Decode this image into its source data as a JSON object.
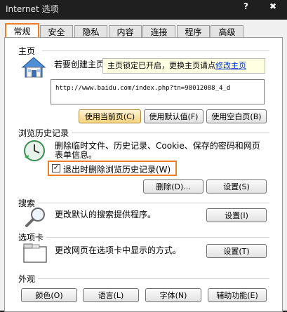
{
  "window": {
    "title": "Internet 选项",
    "help_glyph": "?",
    "close_glyph": "✖"
  },
  "tabs": [
    {
      "label": "常规",
      "active": true
    },
    {
      "label": "安全"
    },
    {
      "label": "隐私"
    },
    {
      "label": "内容"
    },
    {
      "label": "连接"
    },
    {
      "label": "程序"
    },
    {
      "label": "高级"
    }
  ],
  "home": {
    "group": "主页",
    "desc": "若要创建主页",
    "tooltip_text": "主页锁定已开启，更换主页请点",
    "tooltip_link": "修改主页",
    "url": "http://www.baidu.com/index.php?tn=98012088_4_d",
    "buttons": {
      "current": "使用当前页(C)",
      "default": "使用默认值(F)",
      "blank": "使用空白页(B)"
    }
  },
  "history": {
    "group": "浏览历史记录",
    "desc_line1": "删除临时文件、历史记录、Cookie、保存的密码和网页",
    "desc_line2": "表单信息。",
    "checkbox_label": "退出时删除浏览历史记录(W)",
    "checked": true,
    "buttons": {
      "delete": "删除(D)...",
      "settings": "设置(S)"
    }
  },
  "search": {
    "group": "搜索",
    "desc": "更改默认的搜索提供程序。",
    "buttons": {
      "settings": "设置(I)"
    }
  },
  "tabs_group": {
    "group": "选项卡",
    "desc": "更改网页在选项卡中显示的方式。",
    "buttons": {
      "settings": "设置(T)"
    }
  },
  "appearance": {
    "group": "外观",
    "buttons": {
      "colors": "颜色(O)",
      "languages": "语言(L)",
      "fonts": "字体(N)",
      "accessibility": "辅助功能(E)"
    }
  },
  "colors": {
    "accent": "#f07d28",
    "tooltip_bg": "#ffffe1",
    "link": "#0033cc"
  }
}
